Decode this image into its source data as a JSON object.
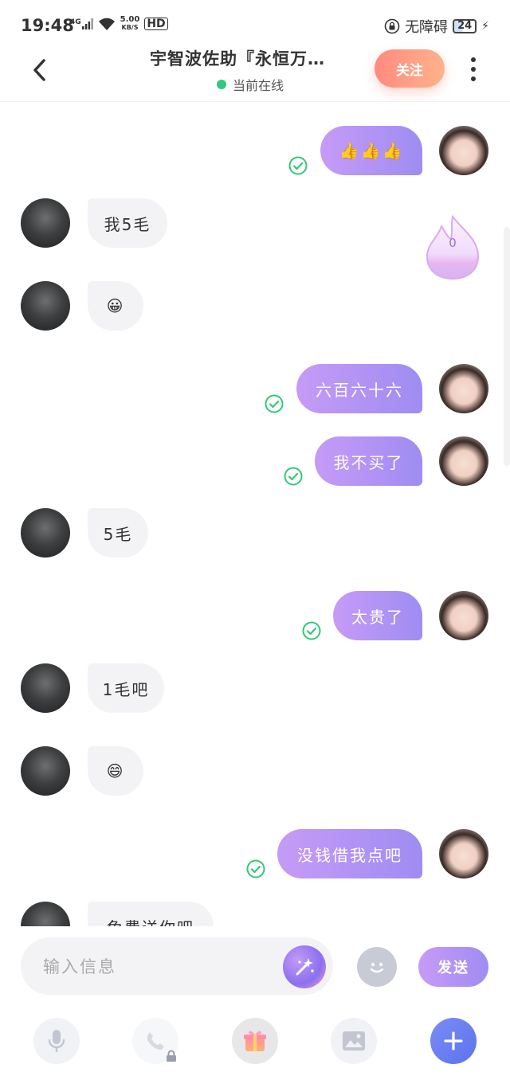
{
  "status_bar": {
    "time": "19:48",
    "network": "4G",
    "speed_value": "5.00",
    "speed_unit": "KB/S",
    "hd": "HD",
    "accessibility": "无障碍",
    "battery": "24"
  },
  "header": {
    "title": "宇智波佐助『永恒万…",
    "status": "当前在线",
    "follow_label": "关注"
  },
  "messages": [
    {
      "side": "me",
      "text": "👍👍👍",
      "read": true
    },
    {
      "side": "them",
      "text": "我5毛"
    },
    {
      "side": "them",
      "text": "😀"
    },
    {
      "side": "me",
      "text": "六百六十六",
      "read": true
    },
    {
      "side": "me",
      "text": "我不买了",
      "read": true
    },
    {
      "side": "them",
      "text": "5毛"
    },
    {
      "side": "me",
      "text": "太贵了",
      "read": true
    },
    {
      "side": "them",
      "text": "1毛吧"
    },
    {
      "side": "them",
      "text": "😄"
    },
    {
      "side": "me",
      "text": "没钱借我点吧",
      "read": true
    },
    {
      "side": "them",
      "text": "免费送你吧"
    }
  ],
  "fire_badge": {
    "count": "0"
  },
  "input": {
    "placeholder": "输入信息",
    "send_label": "发送"
  },
  "colors": {
    "accent_purple": "#a98df3",
    "follow_orange": "#ff9a84",
    "online_green": "#34c77b",
    "check_green": "#34c77b"
  }
}
